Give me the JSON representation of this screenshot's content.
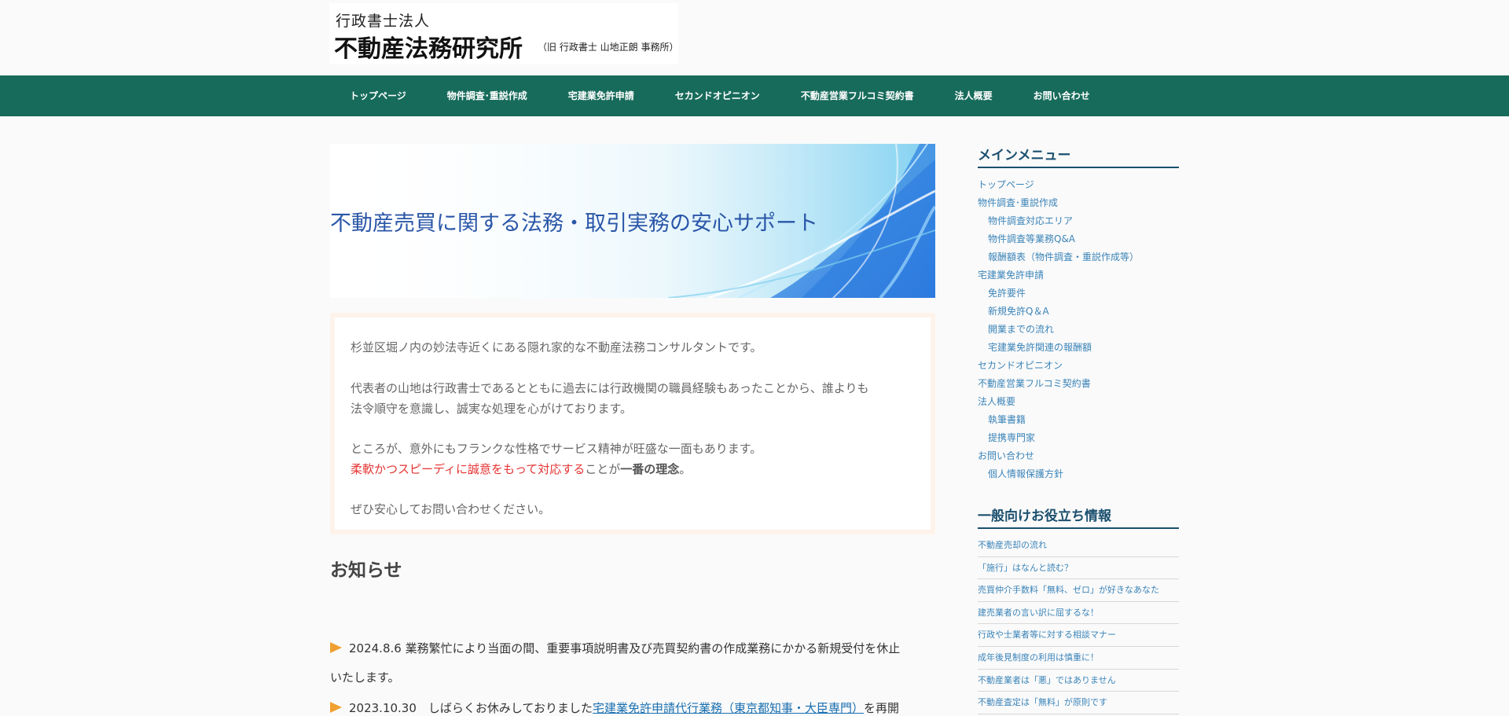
{
  "logo": {
    "line1": "行政書士法人",
    "line2": "不動産法務研究所",
    "line3": "（旧 行政書士 山地正朗 事務所）"
  },
  "nav": [
    "トップページ",
    "物件調査･重説作成",
    "宅建業免許申請",
    "セカンドオピニオン",
    "不動産営業フルコミ契約書",
    "法人概要",
    "お問い合わせ"
  ],
  "hero": {
    "text": "不動産売買に関する法務・取引実務の安心サポート"
  },
  "intro": {
    "p1": "杉並区堀ノ内の妙法寺近くにある隠れ家的な不動産法務コンサルタントです。",
    "p2a": "代表者の山地は行政書士であるとともに過去には行政機関の職員経験もあったことから、誰よりも",
    "p2b": "法令順守を意識し、誠実な処理を心がけております。",
    "p3": "ところが、意外にもフランクな性格でサービス精神が旺盛な一面もあります。",
    "p4_red": "柔軟かつスピーディに誠意をもって対応する",
    "p4_mid": "ことが",
    "p4_bold": "一番の理念",
    "p4_end": "。",
    "p5": "ぜひ安心してお問い合わせください。"
  },
  "news": {
    "title": "お知らせ",
    "item1_line1": "2024.8.6  業務繁忙により当面の間、重要事項説明書及び売買契約書の作成業務にかかる新規受付を休止",
    "item1_line2": "いたします。",
    "item2_pre": "2023.10.30　しばらくお休みしておりました",
    "item2_link": "宅建業免許申請代行業務（東京都知事・大臣専門）",
    "item2_post": "を再開"
  },
  "sidebar": {
    "main_menu_title": "メインメニュー",
    "main_menu": [
      {
        "label": "トップページ",
        "sub": false
      },
      {
        "label": "物件調査･重説作成",
        "sub": false
      },
      {
        "label": "物件調査対応エリア",
        "sub": true
      },
      {
        "label": "物件調査等業務Q&A",
        "sub": true
      },
      {
        "label": "報酬額表（物件調査・重説作成等）",
        "sub": true
      },
      {
        "label": "宅建業免許申請",
        "sub": false
      },
      {
        "label": "免許要件",
        "sub": true
      },
      {
        "label": "新規免許Q＆A",
        "sub": true
      },
      {
        "label": "開業までの流れ",
        "sub": true
      },
      {
        "label": "宅建業免許関連の報酬額",
        "sub": true
      },
      {
        "label": "セカンドオピニオン",
        "sub": false
      },
      {
        "label": "不動産営業フルコミ契約書",
        "sub": false
      },
      {
        "label": "法人概要",
        "sub": false
      },
      {
        "label": "執筆書籍",
        "sub": true
      },
      {
        "label": "提携専門家",
        "sub": true
      },
      {
        "label": "お問い合わせ",
        "sub": false
      },
      {
        "label": "個人情報保護方針",
        "sub": true
      }
    ],
    "info_title": "一般向けお役立ち情報",
    "info_list": [
      "不動産売却の流れ",
      "「施行」はなんと読む？",
      "売買仲介手数料「無料、ゼロ」が好きなあなた",
      "建売業者の言い訳に屈するな！",
      "行政や士業者等に対する相談マナー",
      "成年後見制度の利用は慎重に！",
      "不動産業者は「悪」ではありません",
      "不動産査定は「無料」が原則です"
    ]
  },
  "colors": {
    "nav_bg": "#176b5b",
    "heading": "#1b4f6e",
    "link": "#3b84b8",
    "accent_red": "#e53333",
    "arrow": "#f0a030"
  }
}
